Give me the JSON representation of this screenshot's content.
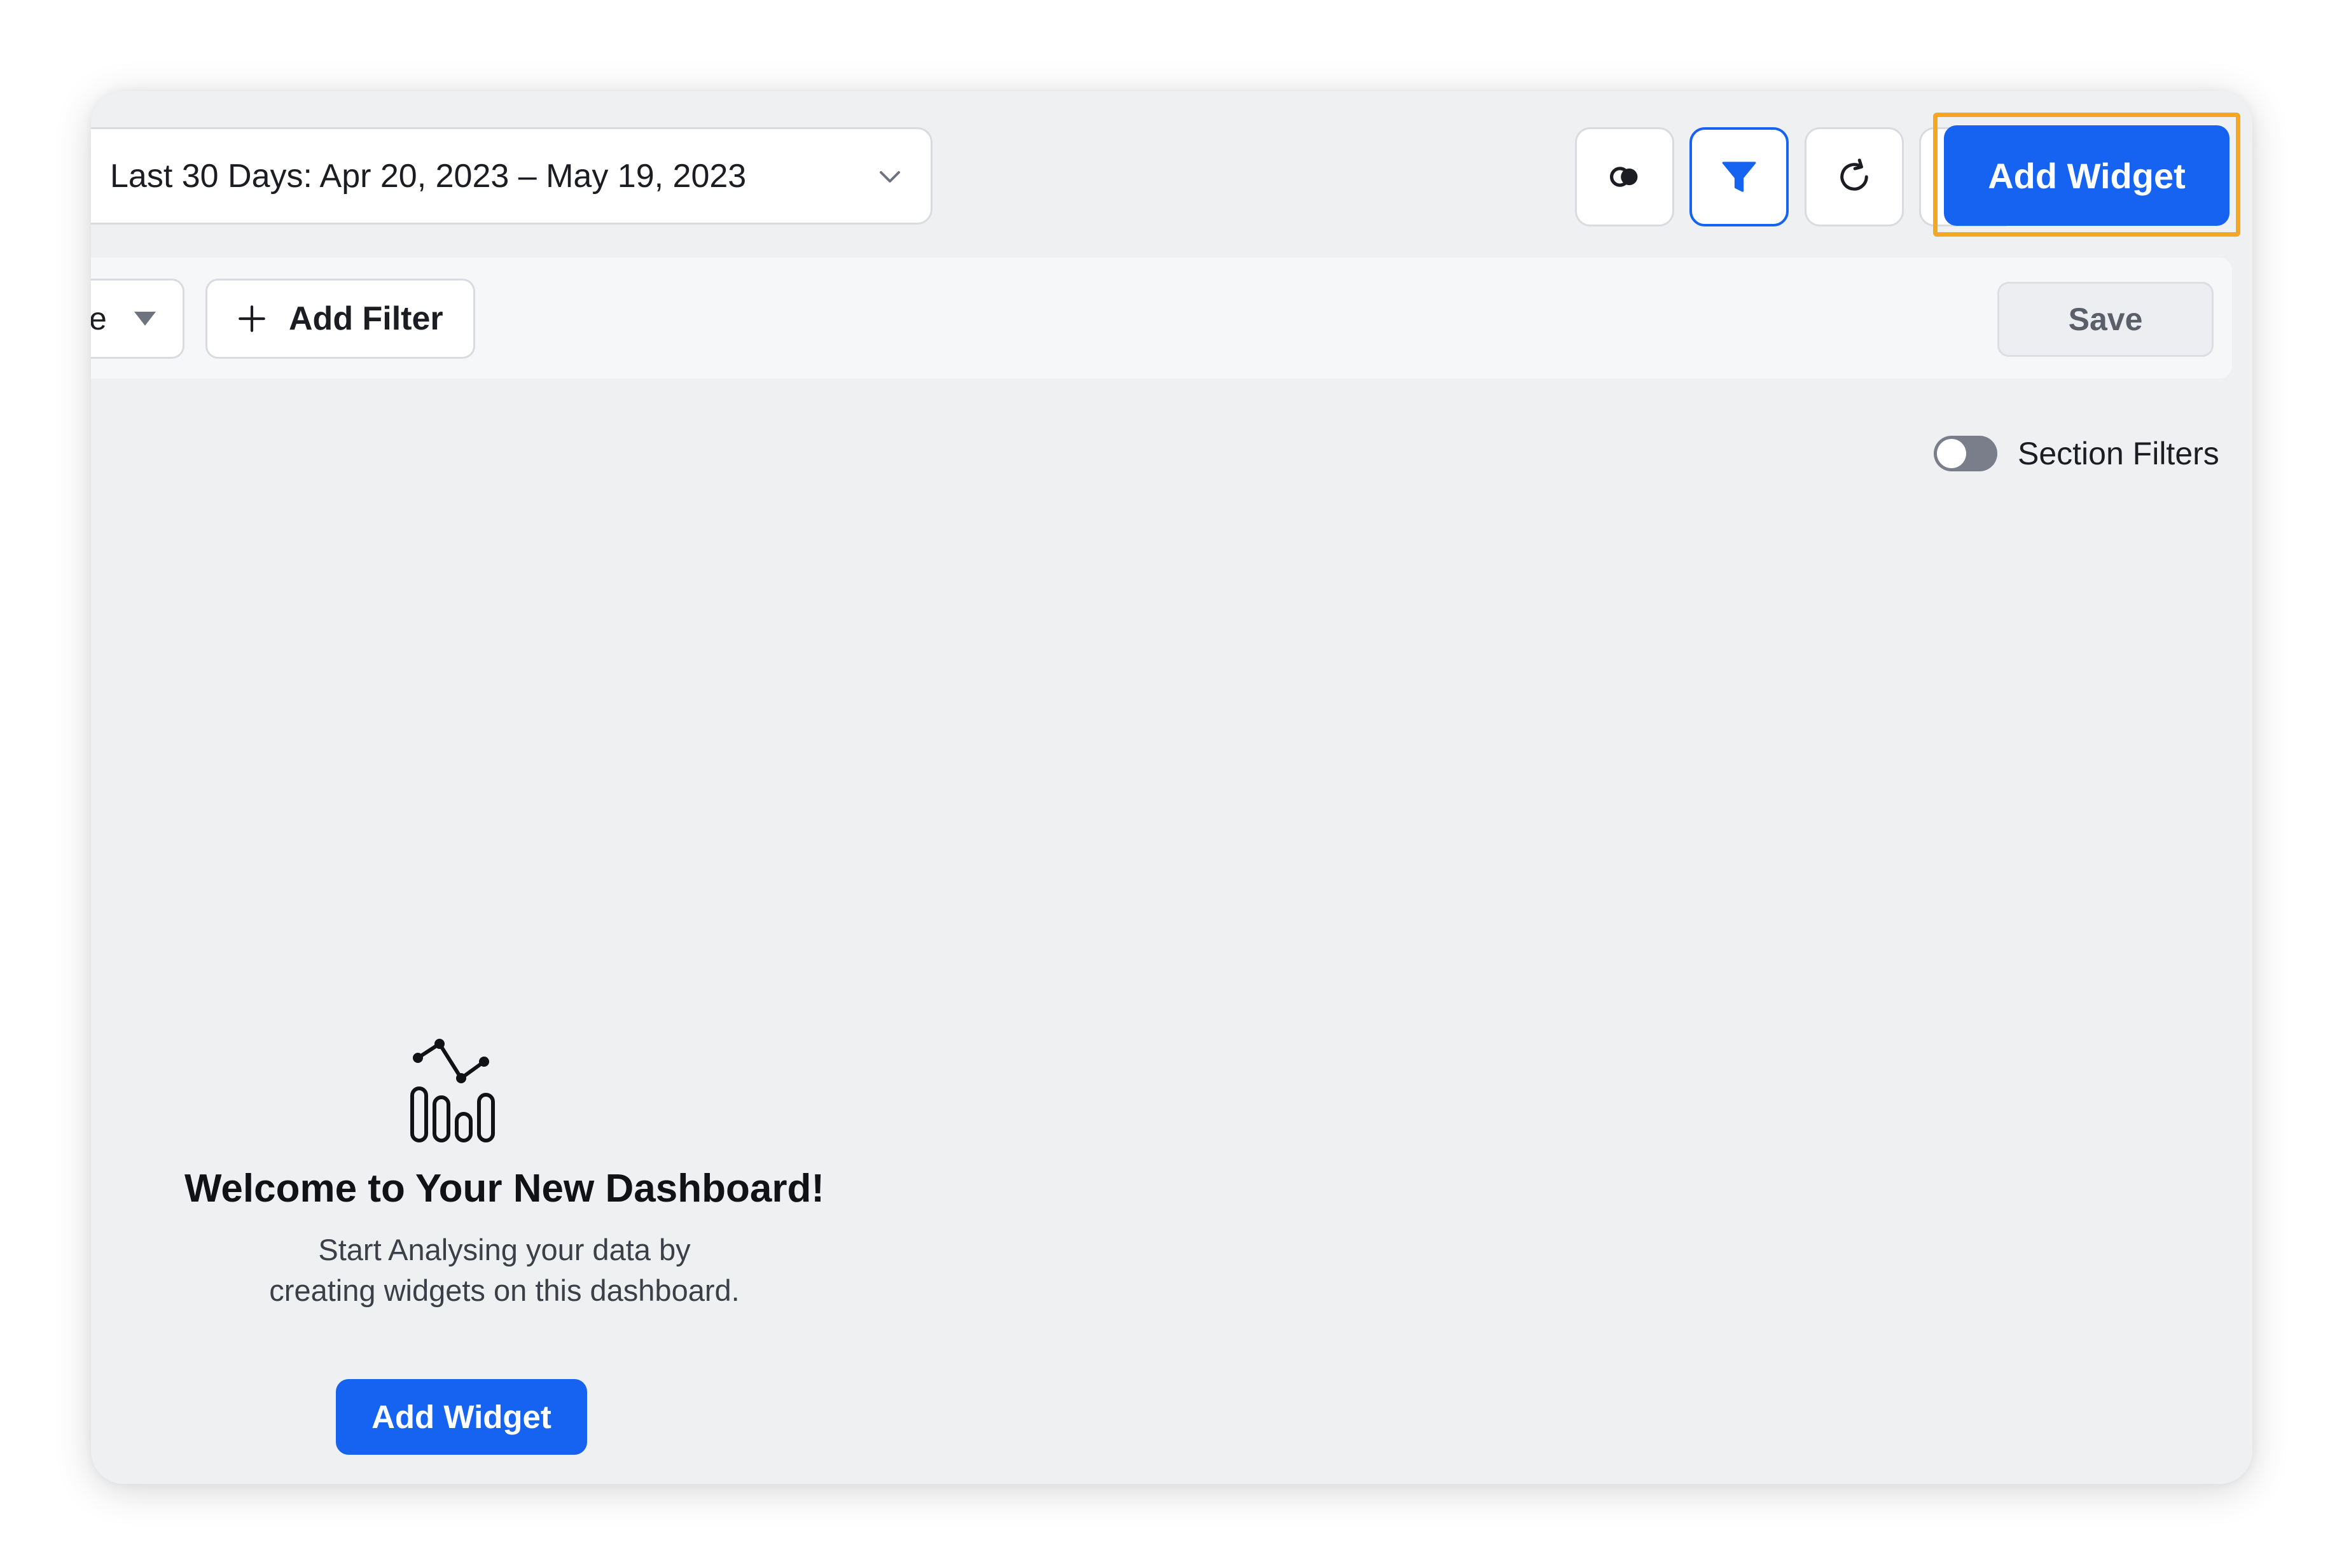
{
  "toolbar": {
    "date_range_label": "Last 30 Days: Apr 20, 2023 – May 19, 2023",
    "add_widget_label": "Add Widget"
  },
  "filter_bar": {
    "partial_select_text": "e",
    "add_filter_label": "Add Filter",
    "save_label": "Save"
  },
  "section_filters": {
    "label": "Section Filters",
    "enabled": false
  },
  "empty_state": {
    "title": "Welcome to Your New Dashboard!",
    "description": "Start Analysing your data by creating widgets on this dashboard.",
    "cta_label": "Add Widget"
  },
  "icons": {
    "toolbar": [
      "toggle-view-icon",
      "filter-icon",
      "refresh-icon",
      "more-icon",
      "chevron-down-icon"
    ],
    "empty_state": "chart-analytics-icon",
    "add_filter": "plus-icon"
  },
  "colors": {
    "primary": "#1563f0",
    "highlight_outline": "#f5a623",
    "surface": "#eff0f2"
  }
}
